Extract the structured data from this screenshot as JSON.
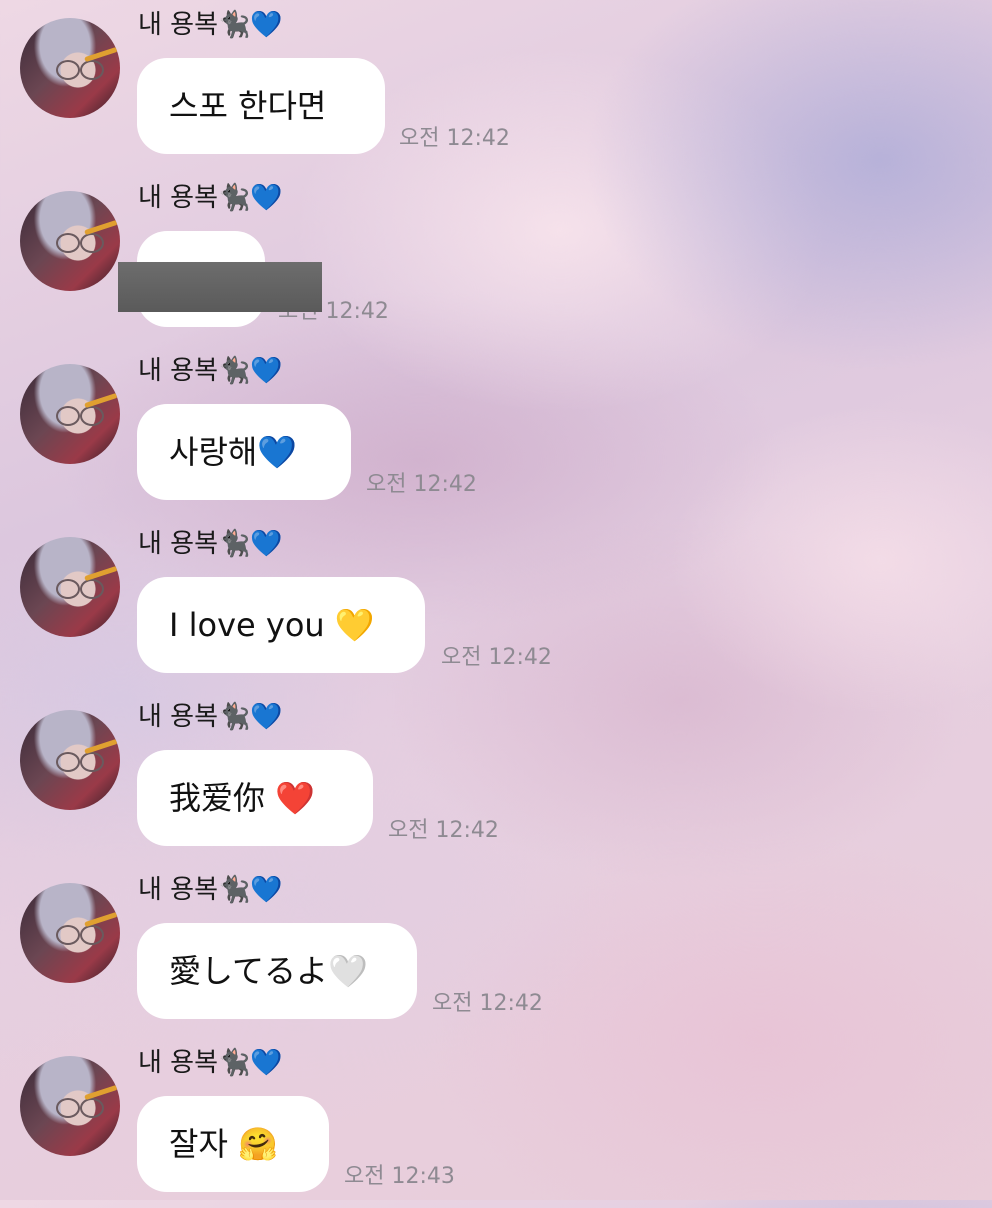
{
  "sender": {
    "name": "내 용복🐈‍⬛💙"
  },
  "messages": [
    {
      "text": "스포 한다면",
      "time": "오전 12:42"
    },
    {
      "text": "",
      "time": "오전 12:42",
      "redacted": true
    },
    {
      "text": "사랑해💙",
      "time": "오전 12:42"
    },
    {
      "text": "I love you 💛",
      "time": "오전 12:42"
    },
    {
      "text": "我爱你 ❤️",
      "time": "오전 12:42"
    },
    {
      "text": "愛してるよ🤍",
      "time": "오전 12:42"
    },
    {
      "text": "잘자 🤗",
      "time": "오전 12:43"
    }
  ]
}
